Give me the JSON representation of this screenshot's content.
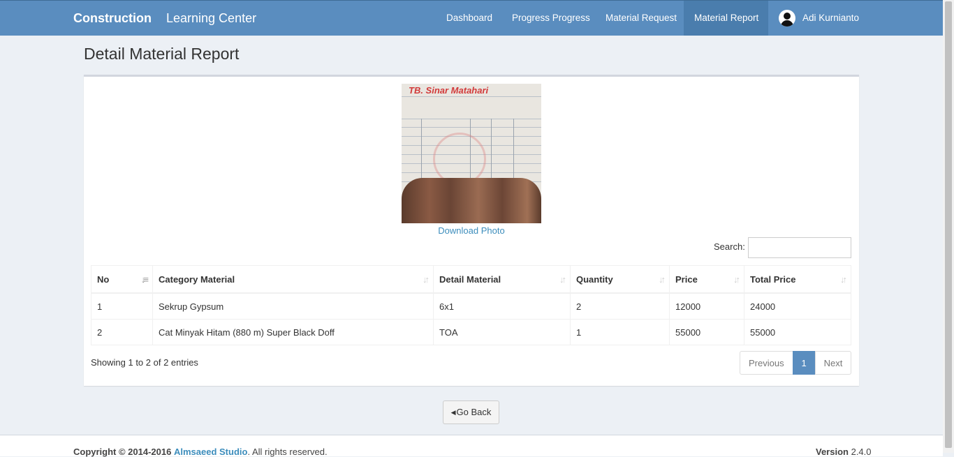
{
  "navbar": {
    "brand": "Construction",
    "brand_sub": "Learning Center",
    "items": [
      "Dashboard",
      "Progress Progress",
      "Material Request",
      "Material Report"
    ],
    "active_item": "Material Report",
    "user_name": "Adi Kurnianto"
  },
  "page": {
    "title": "Detail Material Report"
  },
  "photo": {
    "store_name": "TB. Sinar Matahari",
    "download_label": "Download Photo"
  },
  "search": {
    "label": "Search:",
    "value": ""
  },
  "table": {
    "headers": [
      "No",
      "Category Material",
      "Detail Material",
      "Quantity",
      "Price",
      "Total Price"
    ],
    "rows": [
      [
        "1",
        "Sekrup Gypsum",
        "6x1",
        "2",
        "12000",
        "24000"
      ],
      [
        "2",
        "Cat Minyak Hitam (880 m) Super Black Doff",
        "TOA",
        "1",
        "55000",
        "55000"
      ]
    ]
  },
  "info": "Showing 1 to 2 of 2 entries",
  "pagination": {
    "previous": "Previous",
    "current": "1",
    "next": "Next"
  },
  "go_back": "Go Back",
  "footer": {
    "copyright": "Copyright © 2014-2016",
    "studio": "Almsaeed Studio",
    "rights": ". All rights reserved.",
    "version_label": "Version",
    "version": "2.4.0"
  },
  "colors": {
    "navbar": "#5a8dbf",
    "active_nav": "#4a7dad",
    "link": "#3c8dbc",
    "background": "#ecf0f5"
  }
}
